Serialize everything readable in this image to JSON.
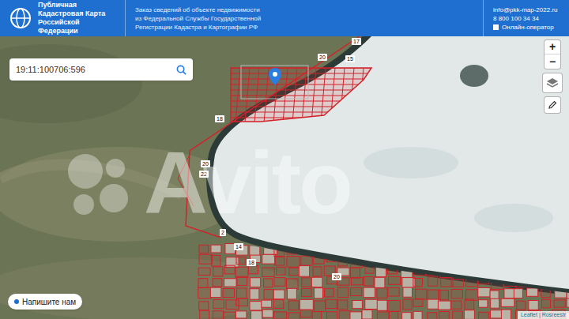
{
  "header": {
    "logo_title": [
      "Публичная",
      "Кадастровая Карта",
      "Российской Федерации"
    ],
    "subtitle": [
      "Заказ сведений об объекте недвижимости",
      "из Федеральной Службы Государственной",
      "Регистрации Кадастра и Картографии РФ"
    ],
    "email": "info@pkk-map-2022.ru",
    "phone": "8 800 100 34 34",
    "operator": {
      "label": "Онлайн-оператор",
      "checked": false
    }
  },
  "search": {
    "value": "19:11:100706:596"
  },
  "zoom": {
    "in": "+",
    "out": "−"
  },
  "parcel_labels": [
    "17",
    "20",
    "15",
    "18",
    "20",
    "2",
    "14",
    "22",
    "18",
    "20"
  ],
  "chat_button": "Напишите нам",
  "attribution": "Leaflet | Rosreestr",
  "watermark": "Avito"
}
